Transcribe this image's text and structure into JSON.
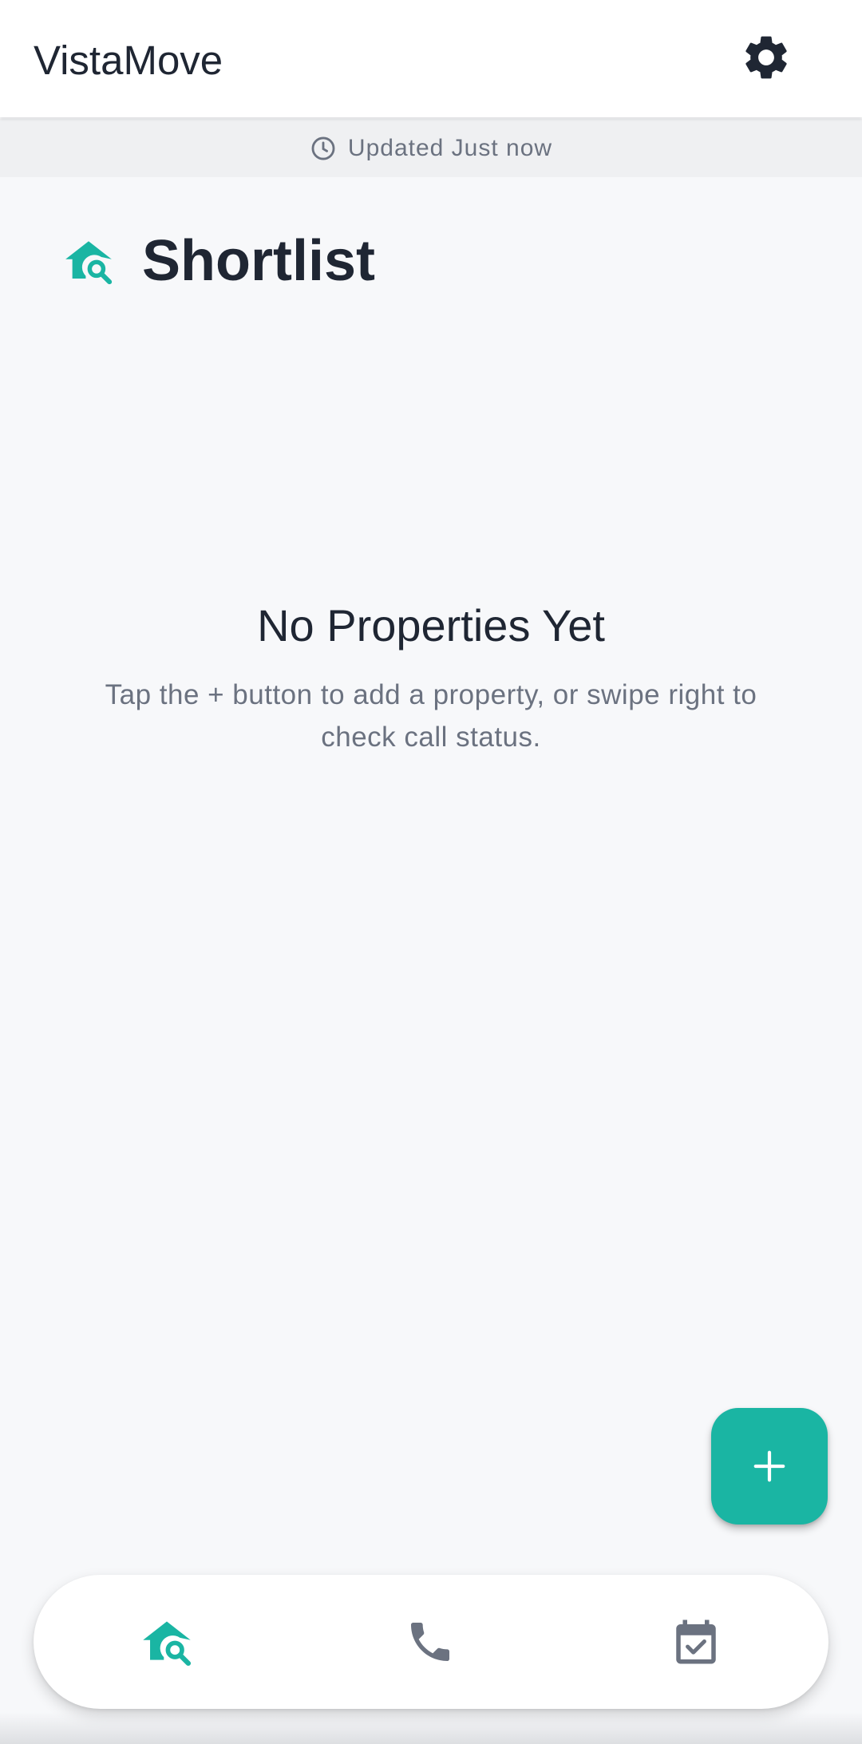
{
  "app": {
    "title": "VistaMove"
  },
  "header": {
    "settings_icon": "gear-icon"
  },
  "status": {
    "updated_text": "Updated Just now",
    "icon": "clock-icon"
  },
  "page": {
    "title": "Shortlist",
    "icon": "home-search-icon"
  },
  "empty_state": {
    "title": "No Properties Yet",
    "description": "Tap the + button to add a property, or swipe right to check call status."
  },
  "fab": {
    "label": "+",
    "icon": "plus-icon"
  },
  "bottom_nav": {
    "items": [
      {
        "name": "shortlist",
        "icon": "home-search-icon",
        "active": true
      },
      {
        "name": "calls",
        "icon": "phone-icon",
        "active": false
      },
      {
        "name": "tasks",
        "icon": "calendar-check-icon",
        "active": false
      }
    ]
  },
  "colors": {
    "accent": "#1ab5a3",
    "text_primary": "#1f2633",
    "text_secondary": "#6b7280",
    "icon_inactive": "#6b7280",
    "background": "#f7f8fa"
  }
}
